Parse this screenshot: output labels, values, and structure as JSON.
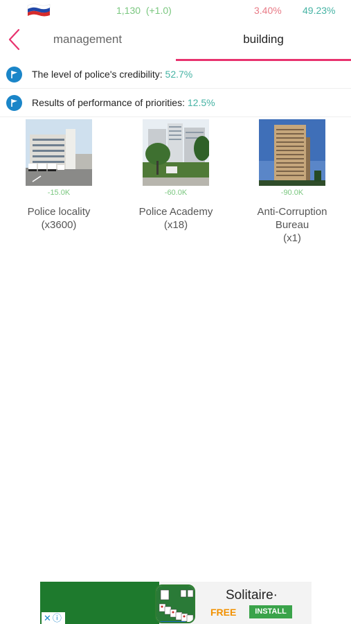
{
  "status": {
    "score": "1,130",
    "score_delta": "(+1.0)",
    "stat_red": "3.40%",
    "stat_teal": "49.23%"
  },
  "tabs": [
    {
      "label": "management"
    },
    {
      "label": "building"
    }
  ],
  "metrics": [
    {
      "label": "The level of police's credibility:",
      "value": "52.7%"
    },
    {
      "label": "Results of performance of priorities:",
      "value": "12.5%"
    }
  ],
  "buildings": [
    {
      "cost": "-15.0K",
      "name": "Police locality",
      "count": "(x3600)"
    },
    {
      "cost": "-60.0K",
      "name": "Police Academy",
      "count": "(x18)"
    },
    {
      "cost": "-90.0K",
      "name": "Anti-Corruption Bureau",
      "count": "(x1)"
    }
  ],
  "ad": {
    "title": "Solitaire·",
    "free_label": "FREE",
    "install_label": "INSTALL"
  },
  "colors": {
    "accent": "#e8326e",
    "positive": "#7ac77f",
    "teal": "#46b3a4",
    "info_icon": "#1a85c8"
  }
}
